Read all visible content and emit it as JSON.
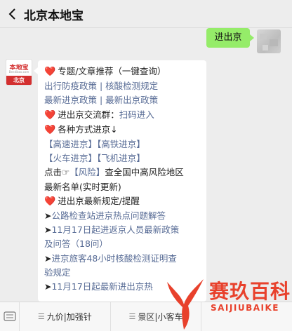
{
  "header": {
    "title": "北京本地宝"
  },
  "user_message": {
    "text": "进出京"
  },
  "account_logo": {
    "line1": "本地宝",
    "line2": "Bendibao.com",
    "line3": "北京"
  },
  "message_lines": [
    {
      "type": "heart",
      "text": "专题/文章推荐（一键查询）"
    },
    {
      "type": "link",
      "text": "出行防疫政策 | 核酸检测规定"
    },
    {
      "type": "link",
      "text": "最新进京政策 | 最新出京政策"
    },
    {
      "type": "heart",
      "text": "进出京交流群：",
      "link": "扫码进入"
    },
    {
      "type": "heart",
      "text": "各种方式进京↓"
    },
    {
      "type": "link",
      "text": "【高速进京】【高铁进京】"
    },
    {
      "type": "link",
      "text": "【火车进京】【飞机进京】"
    },
    {
      "type": "mixed",
      "pre": "点击☞",
      "link": "【风险】",
      "post": "查全国中高风险地区"
    },
    {
      "type": "plain",
      "text": "最新名单(实时更新)"
    },
    {
      "type": "heart",
      "text": "进出京最新规定/提醒"
    },
    {
      "type": "arrowlink",
      "arrow": "➤",
      "text": "公路检查站进京热点问题解答"
    },
    {
      "type": "arrowlink",
      "arrow": "➤",
      "text": "11月17日起进返京人员最新政策"
    },
    {
      "type": "link",
      "text": "及问答（18问）"
    },
    {
      "type": "arrowlink",
      "arrow": "➤",
      "text": "进京旅客48小时核酸检测证明查"
    },
    {
      "type": "link",
      "text": "验规定"
    },
    {
      "type": "arrowlink",
      "arrow": "➤",
      "text": "11月17日起最新进出京热"
    }
  ],
  "menu": {
    "items": [
      "九价|加强针",
      "景区|小客车",
      ""
    ]
  },
  "watermark": {
    "text": "赛玖百科",
    "sub": "SAIJIUBAIKE"
  },
  "colors": {
    "link": "#576b95",
    "heart": "#d0021b",
    "bubble_green": "#95ec69",
    "watermark": "#e8412c"
  }
}
